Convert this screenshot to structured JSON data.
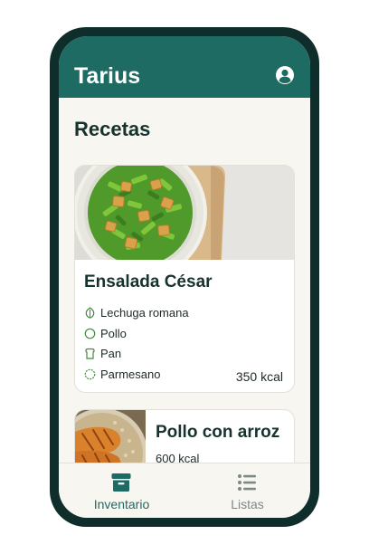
{
  "app": {
    "title": "Tarius"
  },
  "header": {
    "profile_icon": "account-circle-icon"
  },
  "main": {
    "section_title": "Recetas",
    "recipes": [
      {
        "title": "Ensalada César",
        "image_icon": "salad-photo",
        "ingredients": [
          {
            "label": "Lechuga romana",
            "icon": "leaf-icon"
          },
          {
            "label": "Pollo",
            "icon": "circle-icon"
          },
          {
            "label": "Pan",
            "icon": "bread-icon"
          },
          {
            "label": "Parmesano",
            "icon": "cheese-icon"
          }
        ],
        "kcal": "350 kcal"
      },
      {
        "title": "Pollo con arroz",
        "image_icon": "chicken-rice-photo",
        "kcal": "600 kcal"
      }
    ]
  },
  "bottom_nav": {
    "items": [
      {
        "label": "Inventario",
        "icon": "archive-box-icon",
        "active": true
      },
      {
        "label": "Listas",
        "icon": "list-icon",
        "active": false
      }
    ]
  },
  "colors": {
    "primary": "#1d6b63",
    "phone_frame": "#0f2e2b",
    "background": "#f8f6f1",
    "ingredient_icon": "#3f8c3a",
    "inactive_nav": "#7b8a87"
  }
}
